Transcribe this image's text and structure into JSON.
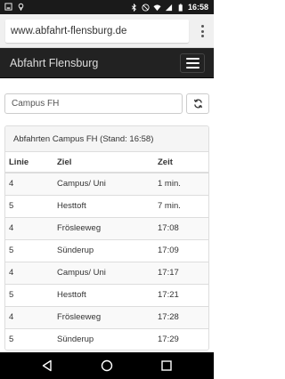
{
  "status_bar": {
    "time": "16:58",
    "icons": [
      "screen-icon",
      "location-icon",
      "bluetooth-icon",
      "silent-icon",
      "wifi-icon",
      "signal-icon",
      "battery-icon"
    ]
  },
  "browser": {
    "url": "www.abfahrt-flensburg.de",
    "menu_icon": "overflow-menu-icon"
  },
  "navbar": {
    "brand": "Abfahrt Flensburg",
    "toggle_icon": "hamburger-icon"
  },
  "search": {
    "value": "Campus FH",
    "refresh_icon": "refresh-icon"
  },
  "panel": {
    "heading": "Abfahrten Campus FH (Stand: 16:58)",
    "columns": [
      "Linie",
      "Ziel",
      "Zeit"
    ],
    "rows": [
      {
        "linie": "4",
        "ziel": "Campus/ Uni",
        "zeit": "1 min."
      },
      {
        "linie": "5",
        "ziel": "Hesttoft",
        "zeit": "7 min."
      },
      {
        "linie": "4",
        "ziel": "Frösleeweg",
        "zeit": "17:08"
      },
      {
        "linie": "5",
        "ziel": "Sünderup",
        "zeit": "17:09"
      },
      {
        "linie": "4",
        "ziel": "Campus/ Uni",
        "zeit": "17:17"
      },
      {
        "linie": "5",
        "ziel": "Hesttoft",
        "zeit": "17:21"
      },
      {
        "linie": "4",
        "ziel": "Frösleeweg",
        "zeit": "17:28"
      },
      {
        "linie": "5",
        "ziel": "Sünderup",
        "zeit": "17:29"
      }
    ]
  },
  "system_nav": {
    "icons": [
      "back-icon",
      "home-icon",
      "recents-icon"
    ]
  },
  "colors": {
    "navbar_bg": "#222222",
    "brand_text": "#dddddd",
    "status_bar_bg": "#1a1a1a",
    "table_stripe": "#f9f9f9"
  }
}
